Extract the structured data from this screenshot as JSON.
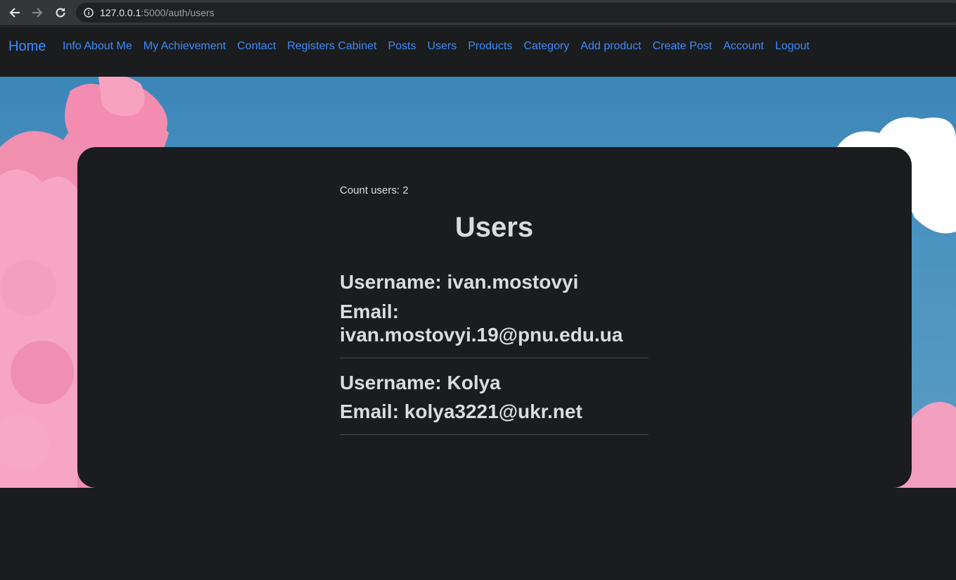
{
  "browser": {
    "url_host": "127.0.0.1",
    "url_rest": ":5000/auth/users"
  },
  "navbar": {
    "brand": "Home",
    "links": [
      "Info About Me",
      "My Achievement",
      "Contact",
      "Registers Cabinet",
      "Posts",
      "Users",
      "Products",
      "Category",
      "Add product",
      "Create Post",
      "Account",
      "Logout"
    ]
  },
  "main": {
    "count_label": "Count users: 2",
    "title": "Users",
    "users": [
      {
        "username": "Username: ivan.mostovyi",
        "email": "Email: ivan.mostovyi.19@pnu.edu.ua"
      },
      {
        "username": "Username: Kolya",
        "email": "Email: kolya3221@ukr.net"
      }
    ]
  },
  "colors": {
    "link": "#3d8bfd",
    "background": "#1b1c1e",
    "text": "#dcdcdc"
  }
}
